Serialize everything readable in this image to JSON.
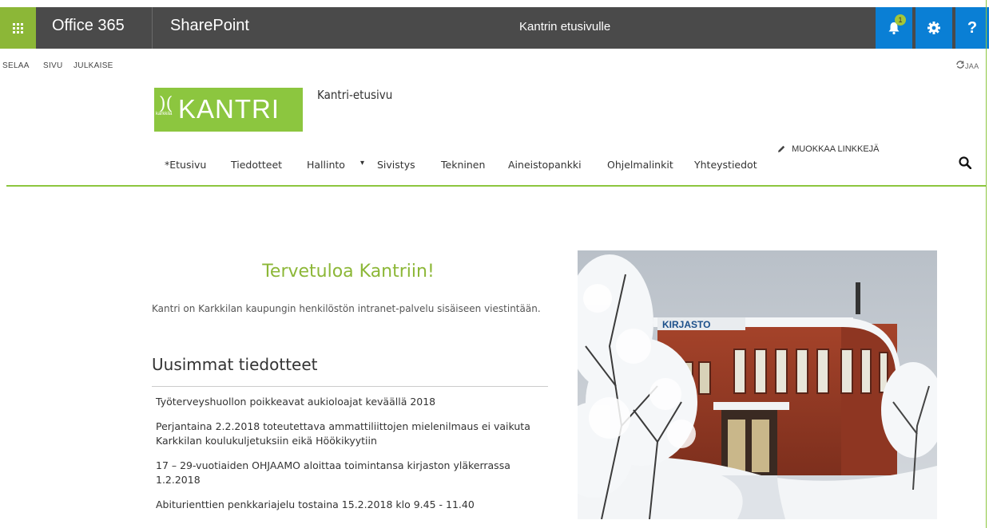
{
  "suitebar": {
    "app_launcher_icon": "waffle-icon",
    "office365": "Office 365",
    "sharepoint": "SharePoint",
    "center_title": "Kantrin etusivulle",
    "notifications_icon": "bell-icon",
    "notification_count": "1",
    "settings_icon": "gear-icon",
    "help_label": "?"
  },
  "ribbon": {
    "items": [
      "SELAA",
      "SIVU",
      "JULKAISE"
    ],
    "share_label": "JAA"
  },
  "header": {
    "logo_text": "KANTRI",
    "logo_small": "karkkila",
    "site_title": "Kantri-etusivu"
  },
  "nav": {
    "items": [
      "*Etusivu",
      "Tiedotteet",
      "Hallinto",
      "Sivistys",
      "Tekninen",
      "Aineistopankki",
      "Ohjelmalinkit",
      "Yhteystiedot"
    ],
    "edit_links": "MUOKKAA LINKKEJÄ"
  },
  "main": {
    "welcome": "Tervetuloa Kantriin!",
    "intro": "Kantri on Karkkilan kaupungin henkilöstön intranet-palvelu sisäiseen viestintään.",
    "news_heading": "Uusimmat tiedotteet",
    "news": [
      "Työterveyshuollon poikkeavat aukioloajat keväällä 2018",
      "Perjantaina 2.2.2018 toteutettava ammattiliittojen mielenilmaus ei vaikuta Karkkilan koulukuljetuksiin eikä Höökikyytiin",
      "17 – 29-vuotiaiden OHJAAMO aloittaa toimintansa kirjaston yläkerrassa 1.2.2018",
      "Abiturienttien penkkariajelu tostaina 15.2.2018 klo 9.45 - 11.40"
    ],
    "photo_sign": "KIRJASTO"
  },
  "colors": {
    "accent_green": "#8cc63f",
    "suitebar_bg": "#4a4a4a",
    "suite_button_blue": "#0a7fd5"
  }
}
